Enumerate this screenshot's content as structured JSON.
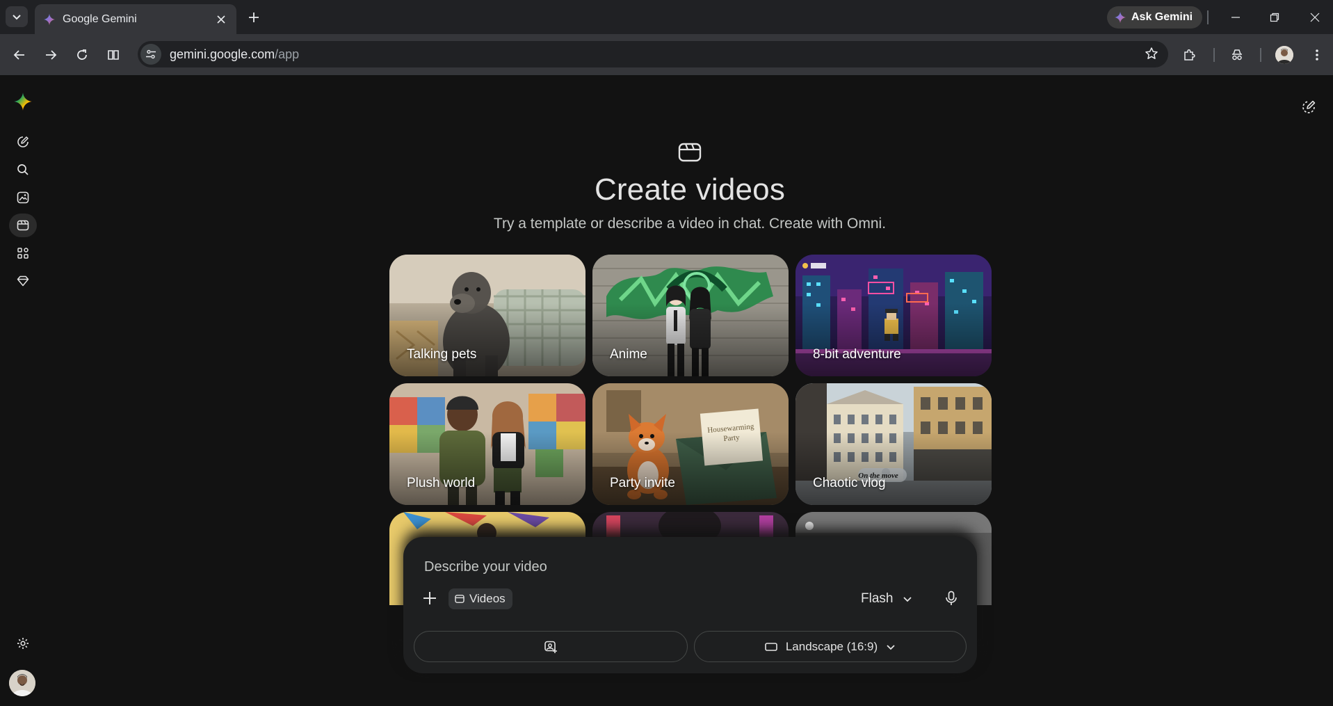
{
  "browser": {
    "tab_title": "Google Gemini",
    "ask_gemini_label": "Ask Gemini",
    "url_host": "gemini.google.com",
    "url_path": "/app"
  },
  "page": {
    "title": "Create videos",
    "subtitle": "Try a template or describe a video in chat. Create with Omni."
  },
  "templates": [
    {
      "label": "Talking pets"
    },
    {
      "label": "Anime"
    },
    {
      "label": "8-bit adventure"
    },
    {
      "label": "Plush world"
    },
    {
      "label": "Party invite"
    },
    {
      "label": "Chaotic vlog"
    }
  ],
  "composer": {
    "placeholder": "Describe your video",
    "tool_chip": "Videos",
    "model": "Flash",
    "aspect_ratio": "Landscape (16:9)"
  },
  "sidebar_icons": [
    "gemini-logo-icon",
    "new-chat-icon",
    "search-icon",
    "image-icon",
    "video-icon",
    "apps-icon",
    "gem-icon",
    "settings-icon"
  ],
  "colors": {
    "background": "#121212",
    "composer": "#1e1f20",
    "chrome_tabbar": "#202124",
    "chrome_toolbar": "#35363a"
  }
}
